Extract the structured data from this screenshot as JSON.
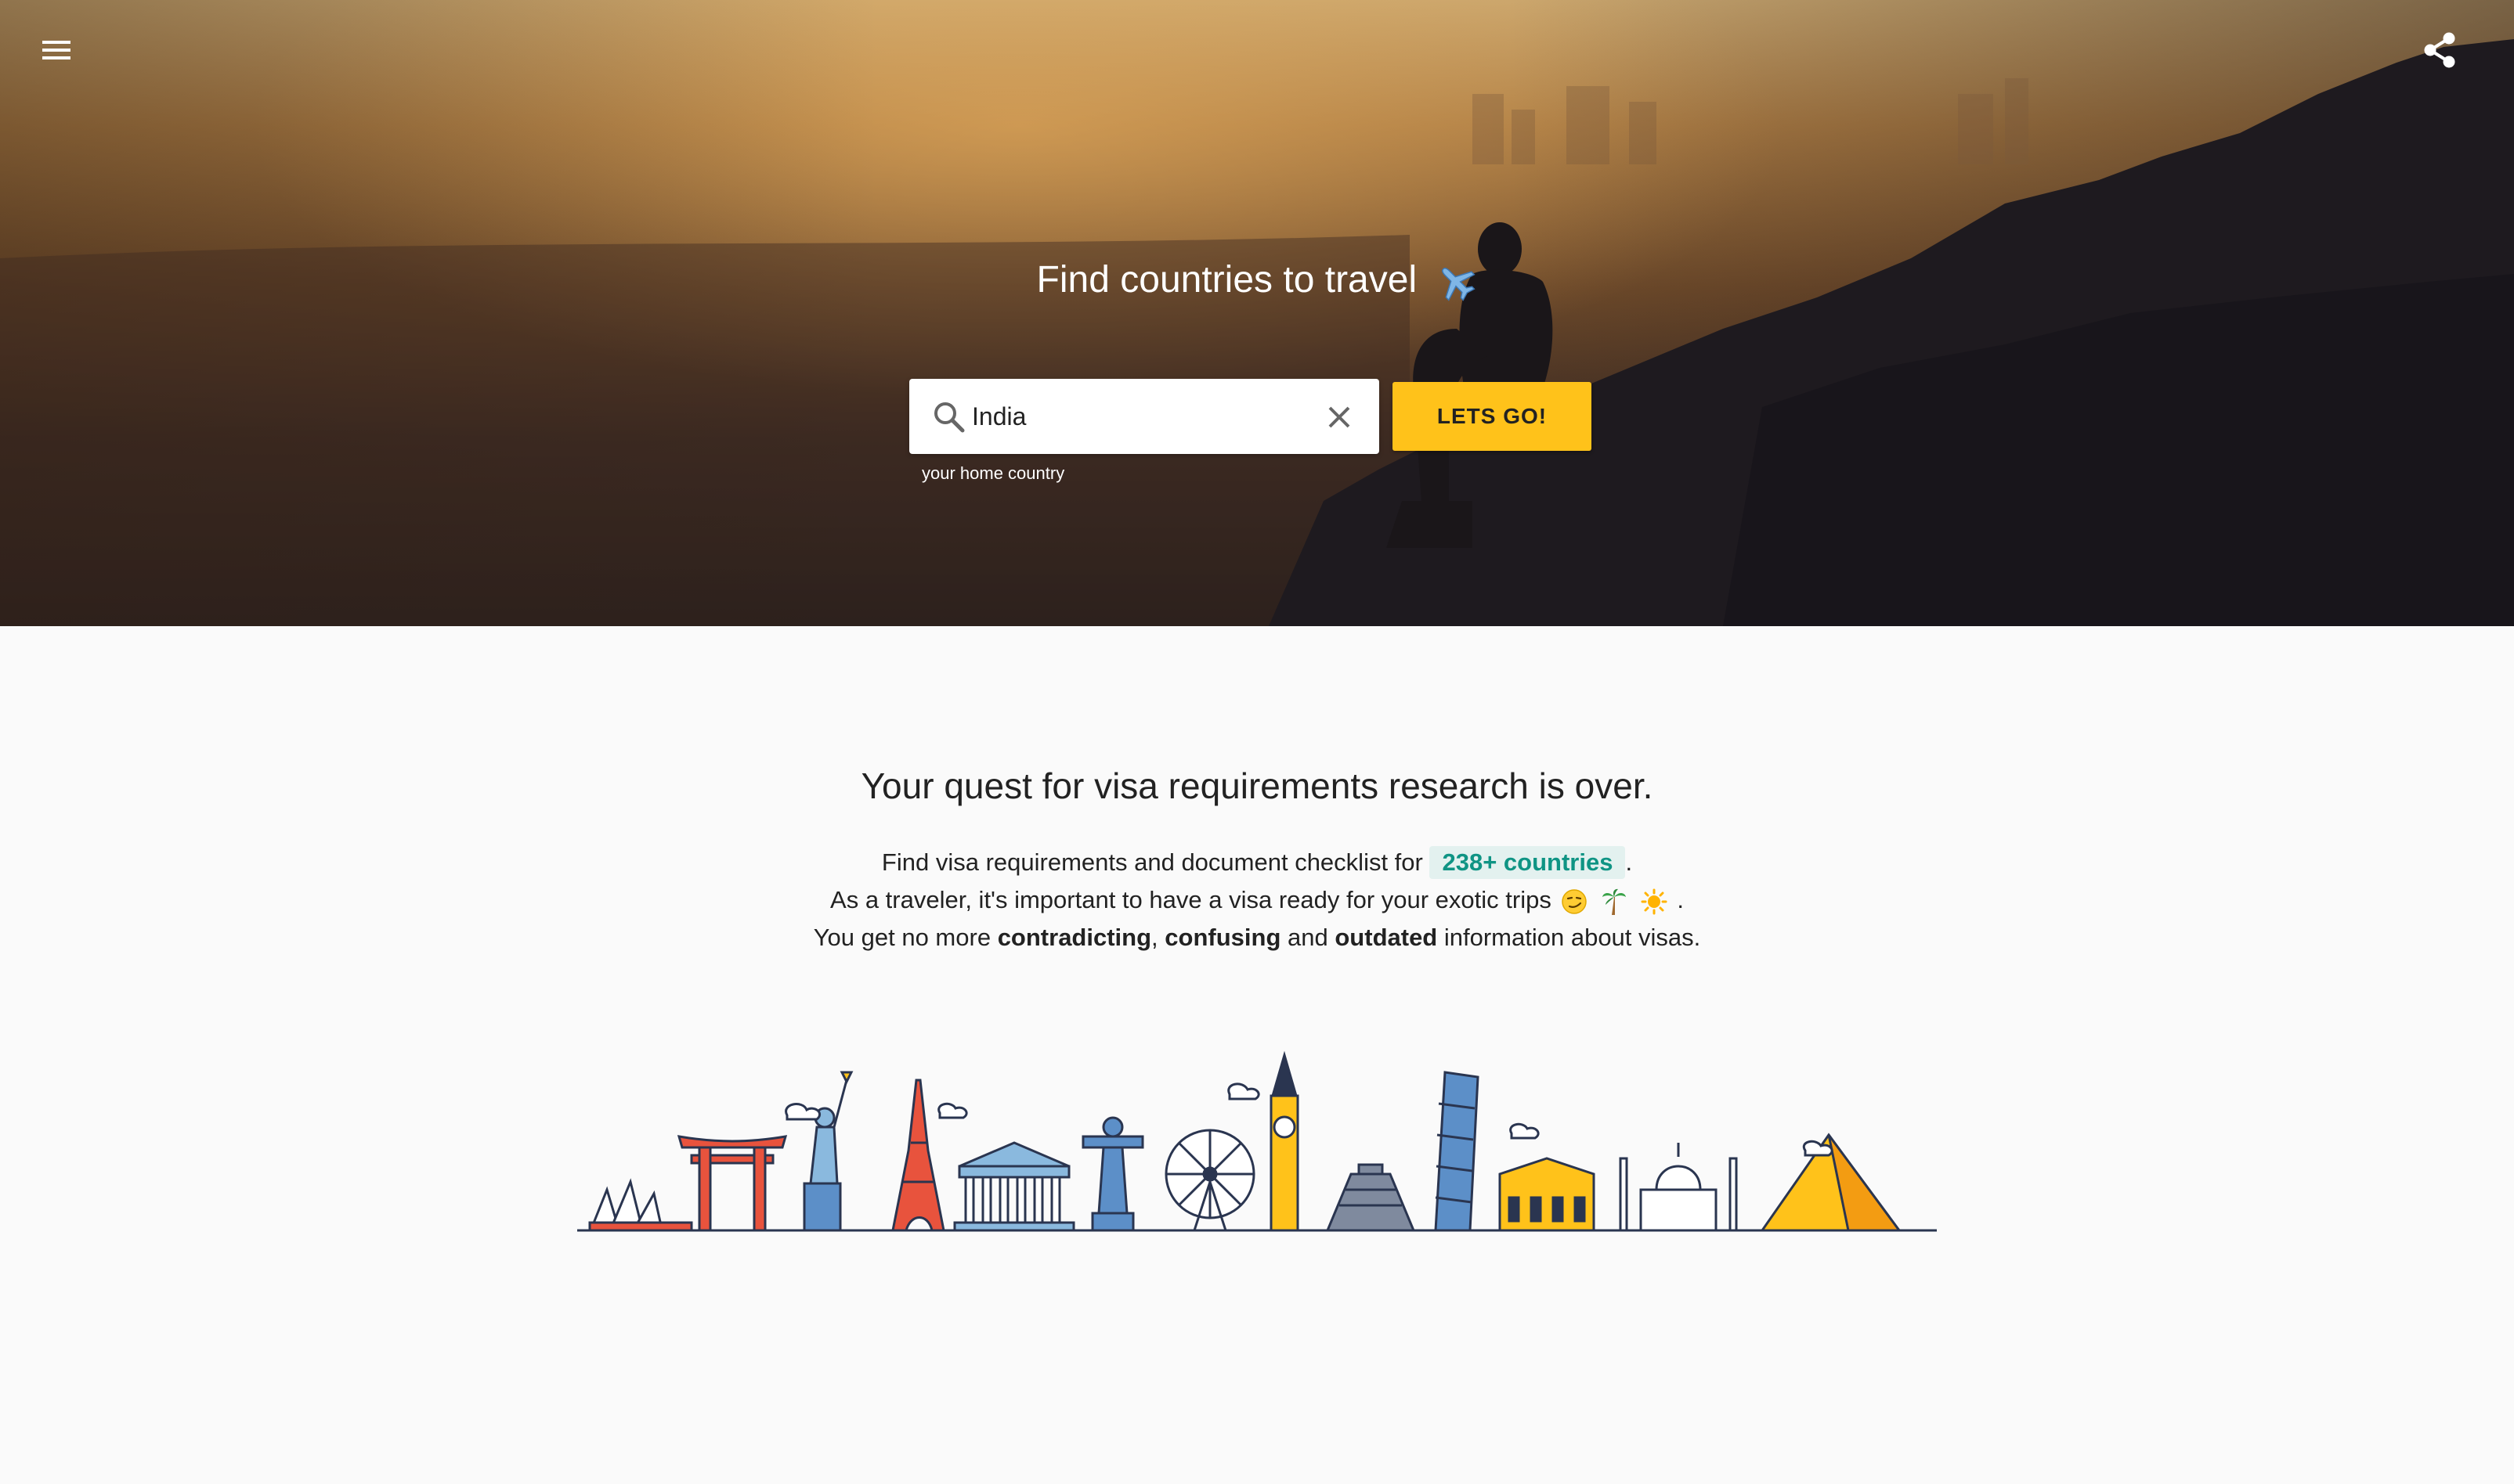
{
  "header": {
    "menu_icon": "hamburger-menu-icon",
    "share_icon": "share-icon"
  },
  "hero": {
    "title": "Find countries to travel",
    "title_icon": "airplane-icon",
    "search": {
      "value": "India",
      "placeholder": "your home country",
      "hint": "your home country",
      "icon": "search-icon",
      "clear_icon": "close-icon"
    },
    "cta_label": "LETS GO!"
  },
  "intro": {
    "headline": "Your quest for visa requirements research is over.",
    "line1_prefix": "Find visa requirements and document checklist for",
    "line1_badge": "238+ countries",
    "line1_suffix": ".",
    "line2_text": "As a traveler, it's important to have a visa ready for your exotic trips",
    "line2_suffix": ".",
    "line3_prefix": "You get no more",
    "line3_bold1": "contradicting",
    "line3_comma": ",",
    "line3_bold2": "confusing",
    "line3_and": "and",
    "line3_bold3": "outdated",
    "line3_suffix": "information about visas."
  },
  "colors": {
    "accent": "#ffc21a",
    "badge_text": "#0f9484",
    "badge_bg": "#e3f1ef",
    "page_bg": "#fafafa"
  },
  "illustration": "world-landmarks-skyline"
}
